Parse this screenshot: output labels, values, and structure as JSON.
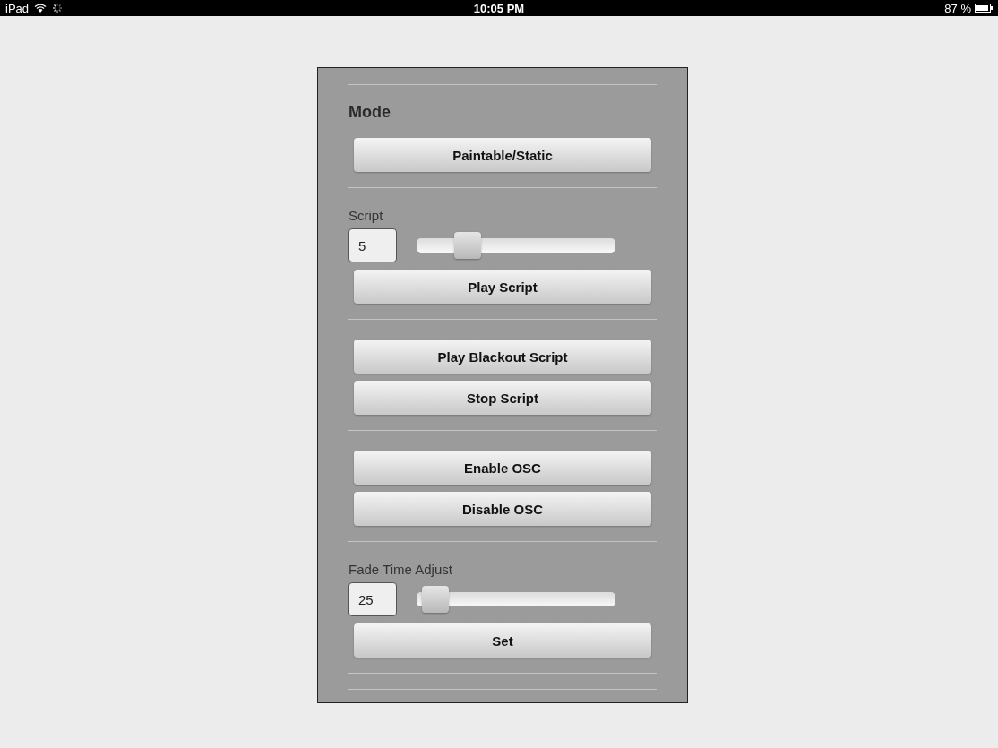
{
  "status_bar": {
    "device": "iPad",
    "time": "10:05 PM",
    "battery": "87 %"
  },
  "sections": [
    {
      "items": [
        {
          "kind": "heading",
          "text": "Mode"
        },
        {
          "kind": "button",
          "label": "Paintable/Static"
        }
      ]
    },
    {
      "items": [
        {
          "kind": "label",
          "text": "Script"
        },
        {
          "kind": "slider",
          "value": "5",
          "level": 0.22
        },
        {
          "kind": "button",
          "label": "Play Script"
        }
      ]
    },
    {
      "items": [
        {
          "kind": "button",
          "label": "Play Blackout Script"
        },
        {
          "kind": "button",
          "label": "Stop Script"
        }
      ]
    },
    {
      "items": [
        {
          "kind": "button",
          "label": "Enable OSC"
        },
        {
          "kind": "button",
          "label": "Disable OSC"
        }
      ]
    },
    {
      "items": [
        {
          "kind": "label",
          "text": "Fade Time Adjust"
        },
        {
          "kind": "slider",
          "value": "25",
          "level": 0.03
        },
        {
          "kind": "button",
          "label": "Set"
        }
      ]
    }
  ]
}
